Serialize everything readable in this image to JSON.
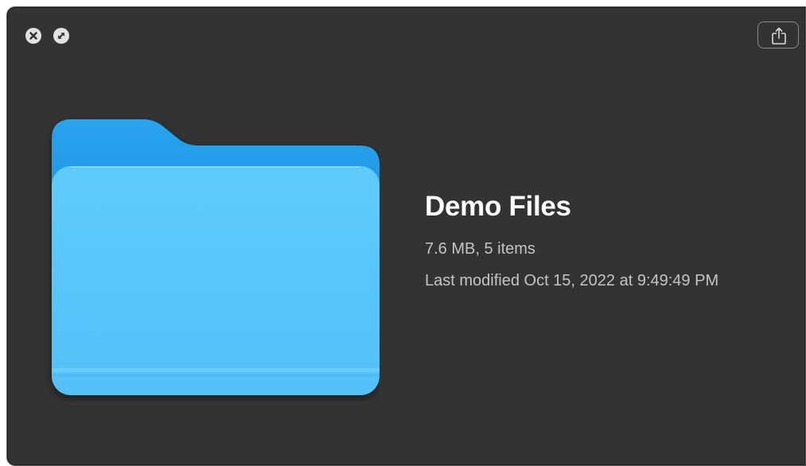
{
  "window": {
    "controls": [
      {
        "name": "close",
        "icon": "close-icon"
      },
      {
        "name": "full-screen",
        "icon": "full-screen-icon"
      }
    ],
    "share_button": {
      "icon": "share-icon"
    }
  },
  "preview": {
    "icon": "folder-icon",
    "title": "Demo Files",
    "size_summary": "7.6 MB, 5 items",
    "modified": "Last modified Oct 15, 2022 at 9:49:49 PM"
  },
  "colors": {
    "window_background": "#333333",
    "folder_blue": "#5ac8fa",
    "folder_back_blue": "#1e95e3",
    "title_text": "#ffffff",
    "secondary_text": "#c4c4c4"
  }
}
